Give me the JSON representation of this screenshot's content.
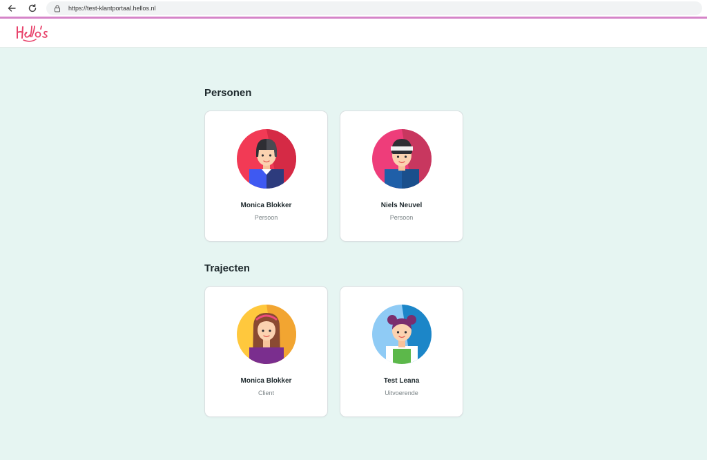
{
  "browser": {
    "url": "https://test-klantportaal.hellos.nl"
  },
  "header": {
    "logo_text": "Hello's"
  },
  "sections": {
    "personen": {
      "title": "Personen",
      "cards": [
        {
          "name": "Monica Blokker",
          "role": "Persoon",
          "avatar": "woman-avatar-red-icon"
        },
        {
          "name": "Niels Neuvel",
          "role": "Persoon",
          "avatar": "man-headband-avatar-pink-icon"
        }
      ]
    },
    "trajecten": {
      "title": "Trajecten",
      "cards": [
        {
          "name": "Monica Blokker",
          "role": "Client",
          "avatar": "woman-long-hair-avatar-yellow-icon"
        },
        {
          "name": "Test Leana",
          "role": "Uitvoerende",
          "avatar": "girl-buns-avatar-blue-icon"
        }
      ]
    }
  },
  "colors": {
    "accent": "#d584c8",
    "logo": "#e8436b",
    "background": "#e6f5f2"
  }
}
